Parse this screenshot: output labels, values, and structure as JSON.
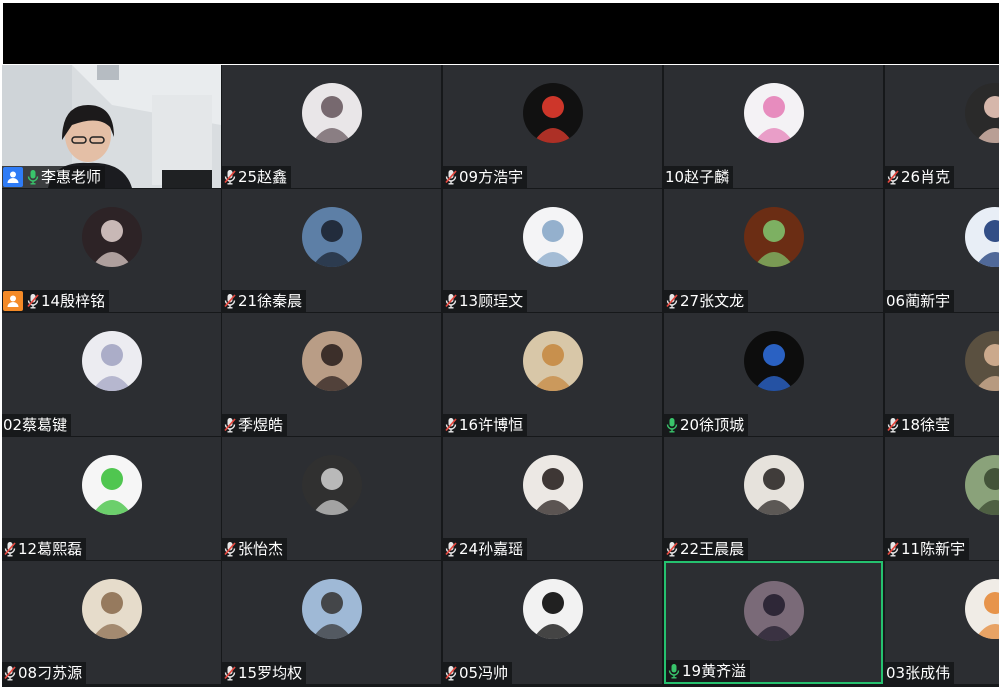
{
  "colors": {
    "tile_bg": "#2c2e32",
    "active_border": "#25c16f",
    "mic_on": "#39c46b",
    "mic_muted": "#e8e8e8",
    "mic_slash": "#e5483f",
    "teacher_badge": "#2f7cf6",
    "assistant_badge": "#f48a27"
  },
  "participants": [
    {
      "name": "李惠老师",
      "mic": "mic-on-icon",
      "badge": "teacher-icon",
      "video": true
    },
    {
      "name": "25赵鑫",
      "mic": "mic-muted-icon",
      "avatar": {
        "bg": "#e9e6e8",
        "fg": "#6a5b62"
      }
    },
    {
      "name": "09方浩宇",
      "mic": "mic-muted-icon",
      "avatar": {
        "bg": "#111111",
        "fg": "#e23b2e"
      }
    },
    {
      "name": "10赵子麟",
      "mic": "none",
      "avatar": {
        "bg": "#f4f2f5",
        "fg": "#e681b8"
      }
    },
    {
      "name": "26肖克",
      "mic": "mic-muted-icon",
      "avatar": {
        "bg": "#2a2a2a",
        "fg": "#e9c7b9"
      }
    },
    {
      "name": "14殷梓铭",
      "mic": "mic-muted-icon",
      "badge": "assistant-icon",
      "avatar": {
        "bg": "#2d2326",
        "fg": "#d9c9c6"
      }
    },
    {
      "name": "21徐秦晨",
      "mic": "mic-muted-icon",
      "avatar": {
        "bg": "#5d7fa6",
        "fg": "#1c2431"
      }
    },
    {
      "name": "13顾珵文",
      "mic": "mic-muted-icon",
      "avatar": {
        "bg": "#f4f4f6",
        "fg": "#8aa9c9"
      }
    },
    {
      "name": "27张文龙",
      "mic": "mic-muted-icon",
      "avatar": {
        "bg": "#6b2d14",
        "fg": "#7fbf6a"
      }
    },
    {
      "name": "06蔺新宇",
      "mic": "none",
      "avatar": {
        "bg": "#e8eef6",
        "fg": "#1e3c7a"
      }
    },
    {
      "name": "02蔡葛键",
      "mic": "none",
      "avatar": {
        "bg": "#ececf1",
        "fg": "#a4a6c3"
      }
    },
    {
      "name": "季煜皓",
      "mic": "mic-muted-icon",
      "avatar": {
        "bg": "#b99d86",
        "fg": "#2f2320"
      }
    },
    {
      "name": "16许博恒",
      "mic": "mic-muted-icon",
      "avatar": {
        "bg": "#d8c7a8",
        "fg": "#c78a43"
      }
    },
    {
      "name": "20徐顶城",
      "mic": "mic-on-icon",
      "avatar": {
        "bg": "#0d0d0d",
        "fg": "#2e6ad6"
      }
    },
    {
      "name": "18徐莹",
      "mic": "mic-muted-icon",
      "avatar": {
        "bg": "#5a5040",
        "fg": "#d7b395"
      }
    },
    {
      "name": "12葛熙磊",
      "mic": "mic-muted-icon",
      "avatar": {
        "bg": "#f6f6f6",
        "fg": "#3ec13e"
      }
    },
    {
      "name": "张怡杰",
      "mic": "mic-muted-icon",
      "avatar": {
        "bg": "#303030",
        "fg": "#c9c9c9"
      }
    },
    {
      "name": "24孙嘉瑶",
      "mic": "mic-muted-icon",
      "avatar": {
        "bg": "#ece8e4",
        "fg": "#2b2321"
      }
    },
    {
      "name": "22王晨晨",
      "mic": "mic-muted-icon",
      "avatar": {
        "bg": "#e6e2dc",
        "fg": "#2e2a28"
      }
    },
    {
      "name": "11陈新宇",
      "mic": "mic-muted-icon",
      "avatar": {
        "bg": "#8aa27a",
        "fg": "#3b4a32"
      }
    },
    {
      "name": "08刁苏源",
      "mic": "mic-muted-icon",
      "avatar": {
        "bg": "#e6dccb",
        "fg": "#8d6f52"
      }
    },
    {
      "name": "15罗均权",
      "mic": "mic-muted-icon",
      "avatar": {
        "bg": "#9fb9d6",
        "fg": "#3a3a3a"
      }
    },
    {
      "name": "05冯帅",
      "mic": "mic-muted-icon",
      "avatar": {
        "bg": "#f2f2f2",
        "fg": "#0a0a0a"
      }
    },
    {
      "name": "19黄齐溢",
      "mic": "mic-on-icon",
      "active": true,
      "avatar": {
        "bg": "#7a6a78",
        "fg": "#262030"
      }
    },
    {
      "name": "03张成伟",
      "mic": "none",
      "avatar": {
        "bg": "#f0ece6",
        "fg": "#e58b3a"
      }
    }
  ]
}
